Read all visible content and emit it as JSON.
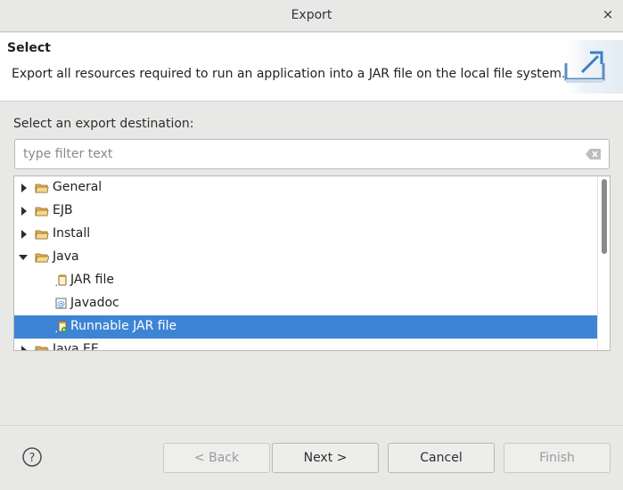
{
  "window": {
    "title": "Export",
    "close_glyph": "×"
  },
  "header": {
    "title": "Select",
    "description": "Export all resources required to run an application into a JAR file on the local file system."
  },
  "filter": {
    "label": "Select an export destination:",
    "placeholder": "type filter text",
    "value": ""
  },
  "tree": {
    "items": [
      {
        "label": "General",
        "kind": "folder",
        "expanded": false
      },
      {
        "label": "EJB",
        "kind": "folder",
        "expanded": false
      },
      {
        "label": "Install",
        "kind": "folder",
        "expanded": false
      },
      {
        "label": "Java",
        "kind": "folder",
        "expanded": true
      },
      {
        "label": "JAR file",
        "kind": "jar",
        "selected": false
      },
      {
        "label": "Javadoc",
        "kind": "javadoc",
        "selected": false
      },
      {
        "label": "Runnable JAR file",
        "kind": "runnable-jar",
        "selected": true
      },
      {
        "label": "Java EE",
        "kind": "folder",
        "expanded": false
      }
    ]
  },
  "buttons": {
    "back": "< Back",
    "next": "Next >",
    "cancel": "Cancel",
    "finish": "Finish"
  },
  "colors": {
    "selection": "#3d84d4",
    "folder": "#e9b44c",
    "accent": "#3a7fc4"
  }
}
